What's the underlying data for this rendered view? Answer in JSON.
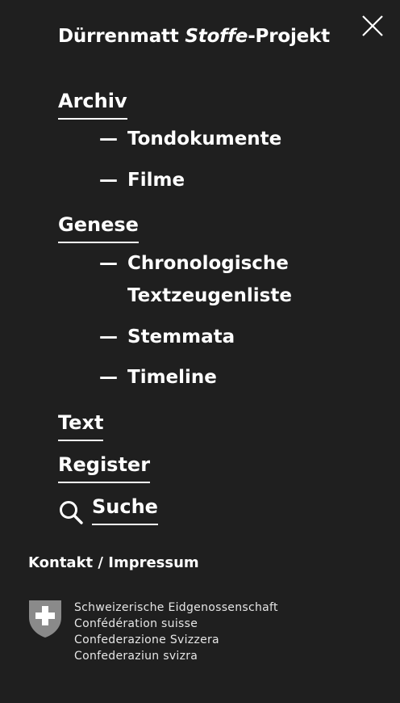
{
  "header": {
    "title_part1": "Dürrenmatt ",
    "title_italic": "Stoffe",
    "title_part2": "-Projekt",
    "close_icon": "close-icon"
  },
  "nav": {
    "archiv": {
      "label": "Archiv",
      "children": [
        {
          "dash": "—",
          "label": "Tondokumente"
        },
        {
          "dash": "—",
          "label": "Filme"
        }
      ]
    },
    "genese": {
      "label": "Genese",
      "children": [
        {
          "dash": "—",
          "label_line1": "Chronologische",
          "label_line2": "Textzeugenliste"
        },
        {
          "dash": "—",
          "label": "Stemmata"
        },
        {
          "dash": "—",
          "label": "Timeline"
        }
      ]
    },
    "text": {
      "label": "Text"
    },
    "register": {
      "label": "Register"
    },
    "suche": {
      "label": "Suche",
      "icon": "search-icon"
    }
  },
  "footer": {
    "link": "Kontakt / Impressum",
    "confederation_lines": [
      "Schweizerische Eidgenossenschaft",
      "Confédération suisse",
      "Confederazione Svizzera",
      "Confederaziun svizra"
    ],
    "emblem": "swiss-shield-icon"
  },
  "colors": {
    "background": "#1f1f1f",
    "text": "#ffffff",
    "shield_red": "#8a8a8a"
  }
}
